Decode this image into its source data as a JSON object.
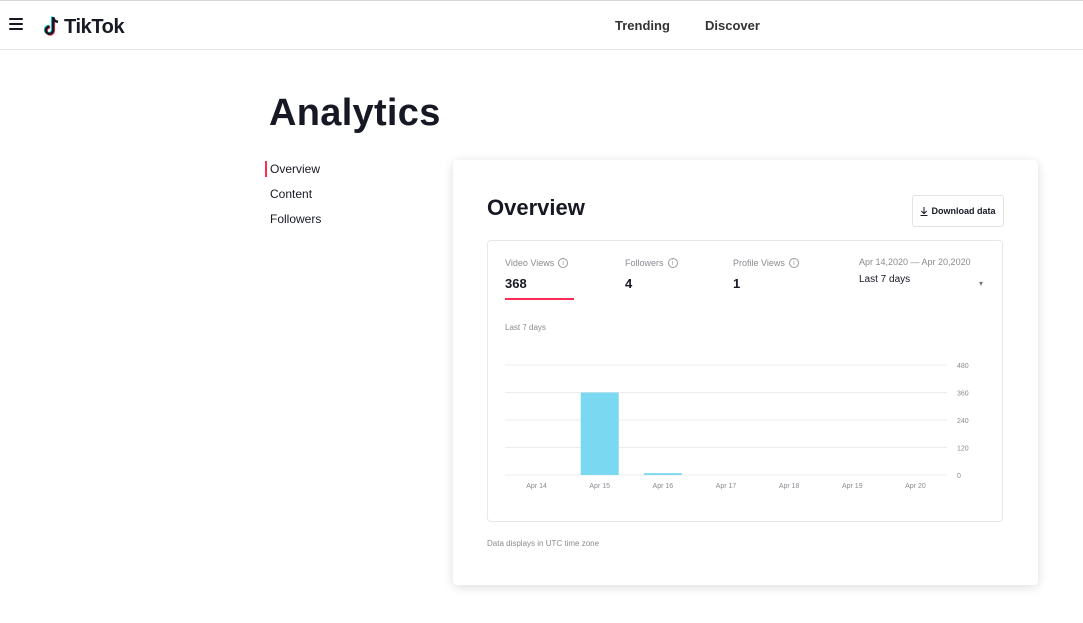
{
  "header": {
    "brand": "TikTok",
    "nav": [
      {
        "label": "Trending"
      },
      {
        "label": "Discover"
      }
    ]
  },
  "page": {
    "title": "Analytics"
  },
  "sidebar": {
    "items": [
      {
        "label": "Overview",
        "active": true
      },
      {
        "label": "Content"
      },
      {
        "label": "Followers"
      }
    ]
  },
  "card": {
    "title": "Overview",
    "download_label": "Download data",
    "metrics": [
      {
        "label": "Video Views",
        "value": "368",
        "selected": true
      },
      {
        "label": "Followers",
        "value": "4"
      },
      {
        "label": "Profile Views",
        "value": "1"
      }
    ],
    "date_range": {
      "dates": "Apr 14,2020 — Apr 20,2020",
      "selected": "Last 7 days"
    },
    "chart_caption": "Last 7 days",
    "footnote": "Data displays in UTC time zone"
  },
  "colors": {
    "accent": "#fe2c55",
    "bar": "#7ad8f0",
    "grid": "#ececec",
    "axis_text": "#8a8b91"
  },
  "icons": {
    "menu": "hamburger-icon",
    "logo": "tiktok-note-icon",
    "download": "download-arrow-icon",
    "info": "info-circle-icon",
    "caret": "caret-down-icon"
  },
  "chart_data": {
    "type": "bar",
    "categories": [
      "Apr 14",
      "Apr 15",
      "Apr 16",
      "Apr 17",
      "Apr 18",
      "Apr 19",
      "Apr 20"
    ],
    "values": [
      0,
      360,
      8,
      0,
      0,
      0,
      0
    ],
    "title": "",
    "xlabel": "",
    "ylabel": "",
    "ylim": [
      0,
      480
    ],
    "yticks": [
      0,
      120,
      240,
      360,
      480
    ],
    "y_axis_side": "right",
    "grid": true
  }
}
